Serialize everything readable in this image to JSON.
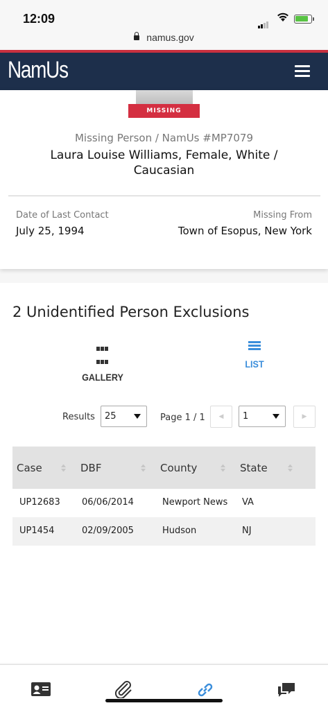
{
  "status_bar": {
    "time": "12:09"
  },
  "browser": {
    "url": "namus.gov"
  },
  "header": {
    "logo": "NamUs",
    "menu_icon": "hamburger-menu-icon"
  },
  "person": {
    "badge": "MISSING",
    "case_line": "Missing Person / NamUs #MP7079",
    "name": "Laura Louise Williams, Female, White / Caucasian",
    "date_label": "Date of Last Contact",
    "date_value": "July 25, 1994",
    "from_label": "Missing From",
    "from_value": "Town of Esopus, New York"
  },
  "exclusions": {
    "title": "2 Unidentified Person Exclusions",
    "views": [
      {
        "label": "GALLERY",
        "icon": "grid-icon",
        "active": false
      },
      {
        "label": "LIST",
        "icon": "list-icon",
        "active": true
      }
    ],
    "results_label": "Results",
    "results_value": "25",
    "page_label": "Page 1 / 1",
    "page_value": "1",
    "columns": [
      "Case",
      "DBF",
      "County",
      "State"
    ],
    "rows": [
      [
        "UP12683",
        "06/06/2014",
        "Newport News",
        "VA"
      ],
      [
        "UP1454",
        "02/09/2005",
        "Hudson",
        "NJ"
      ]
    ]
  },
  "tabbar": {
    "tabs": [
      "id-card-icon",
      "paperclip-icon",
      "link-icon",
      "chat-icon"
    ],
    "active_color": "#3b8edb"
  },
  "colors": {
    "header_bg": "#1d2f4b",
    "accent_red": "#d42f41",
    "link_blue": "#3b8edb"
  }
}
